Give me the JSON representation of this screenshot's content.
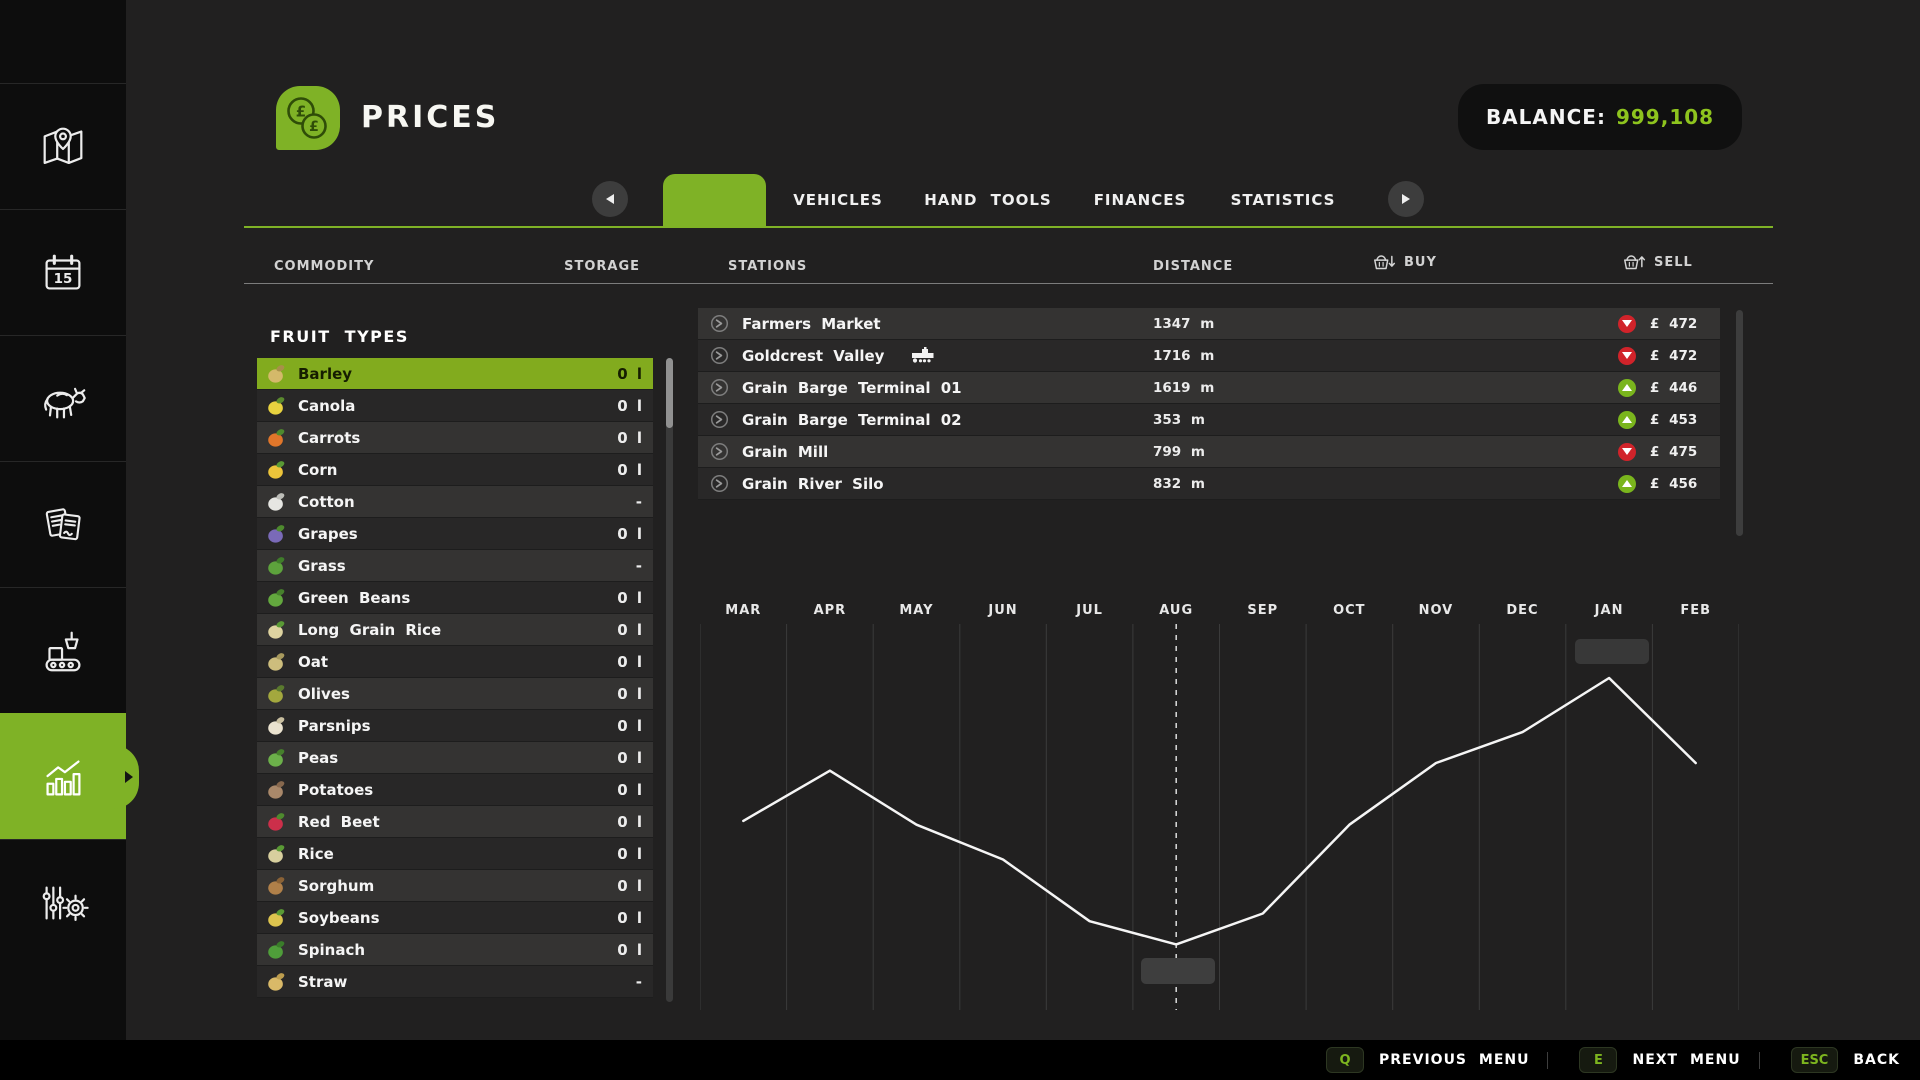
{
  "header": {
    "title": "PRICES",
    "currency_symbol": "£",
    "balance_label": "BALANCE:",
    "balance_value": "999,108"
  },
  "sidebar": {
    "active_item": "statistics",
    "items": [
      {
        "icon": "map-icon"
      },
      {
        "icon": "calendar-icon",
        "day": "15"
      },
      {
        "icon": "animals-icon"
      },
      {
        "icon": "contracts-icon"
      },
      {
        "icon": "production-icon"
      },
      {
        "icon": "statistics-icon",
        "active": true
      },
      {
        "icon": "settings-icon"
      }
    ]
  },
  "tabs": {
    "active_tab_label": "",
    "items": [
      "VEHICLES",
      "HAND TOOLS",
      "FINANCES",
      "STATISTICS"
    ]
  },
  "table_header": {
    "commodity": "COMMODITY",
    "storage": "STORAGE",
    "stations": "STATIONS",
    "distance": "DISTANCE",
    "buy": "BUY",
    "sell": "SELL"
  },
  "fruit_panel": {
    "title": "FRUIT TYPES",
    "items": [
      {
        "name": "Barley",
        "storage": "0 l",
        "selected": true,
        "color": "#d4b96a",
        "accent": "#a8904a"
      },
      {
        "name": "Canola",
        "storage": "0 l",
        "selected": false,
        "color": "#e8d23f",
        "accent": "#5a8a2e"
      },
      {
        "name": "Carrots",
        "storage": "0 l",
        "selected": false,
        "color": "#e0762a",
        "accent": "#4e8a2e"
      },
      {
        "name": "Corn",
        "storage": "0 l",
        "selected": false,
        "color": "#ecc43a",
        "accent": "#5a9a35"
      },
      {
        "name": "Cotton",
        "storage": "-",
        "selected": false,
        "color": "#e6e6e2",
        "accent": "#bdbdb8"
      },
      {
        "name": "Grapes",
        "storage": "0 l",
        "selected": false,
        "color": "#7a6ab8",
        "accent": "#4e8a2e"
      },
      {
        "name": "Grass",
        "storage": "-",
        "selected": false,
        "color": "#5da23c",
        "accent": "#3f7d2a"
      },
      {
        "name": "Green Beans",
        "storage": "0 l",
        "selected": false,
        "color": "#63a83e",
        "accent": "#46802c"
      },
      {
        "name": "Long Grain Rice",
        "storage": "0 l",
        "selected": false,
        "color": "#ded3a0",
        "accent": "#5a9a35"
      },
      {
        "name": "Oat",
        "storage": "0 l",
        "selected": false,
        "color": "#cdbd7d",
        "accent": "#a89a5e"
      },
      {
        "name": "Olives",
        "storage": "0 l",
        "selected": false,
        "color": "#a3a83e",
        "accent": "#5a7a2e"
      },
      {
        "name": "Parsnips",
        "storage": "0 l",
        "selected": false,
        "color": "#eae2cf",
        "accent": "#c9bfa0"
      },
      {
        "name": "Peas",
        "storage": "0 l",
        "selected": false,
        "color": "#6cb04a",
        "accent": "#46802c"
      },
      {
        "name": "Potatoes",
        "storage": "0 l",
        "selected": false,
        "color": "#a9886a",
        "accent": "#87684e"
      },
      {
        "name": "Red Beet",
        "storage": "0 l",
        "selected": false,
        "color": "#cc2f4a",
        "accent": "#4e8a2e"
      },
      {
        "name": "Rice",
        "storage": "0 l",
        "selected": false,
        "color": "#d8cf9e",
        "accent": "#5a9a35"
      },
      {
        "name": "Sorghum",
        "storage": "0 l",
        "selected": false,
        "color": "#b08049",
        "accent": "#8a6236"
      },
      {
        "name": "Soybeans",
        "storage": "0 l",
        "selected": false,
        "color": "#ddc44e",
        "accent": "#5a9a35"
      },
      {
        "name": "Spinach",
        "storage": "0 l",
        "selected": false,
        "color": "#4f9e3a",
        "accent": "#3a7d2a"
      },
      {
        "name": "Straw",
        "storage": "-",
        "selected": false,
        "color": "#d9b968",
        "accent": "#bd9d4e"
      }
    ]
  },
  "stations": [
    {
      "name": "Farmers Market",
      "train": false,
      "distance": "1347 m",
      "trend": "down",
      "sell_price": "£ 472"
    },
    {
      "name": "Goldcrest Valley",
      "train": true,
      "distance": "1716 m",
      "trend": "down",
      "sell_price": "£ 472"
    },
    {
      "name": "Grain Barge Terminal 01",
      "train": false,
      "distance": "1619 m",
      "trend": "up",
      "sell_price": "£ 446"
    },
    {
      "name": "Grain Barge Terminal 02",
      "train": false,
      "distance": "353 m",
      "trend": "up",
      "sell_price": "£ 453"
    },
    {
      "name": "Grain Mill",
      "train": false,
      "distance": "799 m",
      "trend": "down",
      "sell_price": "£ 475"
    },
    {
      "name": "Grain River Silo",
      "train": false,
      "distance": "832 m",
      "trend": "up",
      "sell_price": "£ 456"
    }
  ],
  "chart_data": {
    "type": "line",
    "title": "",
    "xlabel": "",
    "ylabel": "",
    "x": [
      "MAR",
      "APR",
      "MAY",
      "JUN",
      "JUL",
      "AUG",
      "SEP",
      "OCT",
      "NOV",
      "DEC",
      "JAN",
      "FEB"
    ],
    "values": [
      0.49,
      0.62,
      0.48,
      0.39,
      0.23,
      0.17,
      0.25,
      0.48,
      0.64,
      0.72,
      0.86,
      0.64
    ],
    "values_unit": "fraction_of_plot_height (no y-axis labels shown in UI)",
    "current_month": "AUG",
    "current_month_index": 5,
    "peak_month": "JAN",
    "grid": "vertical_month_gridlines",
    "line_color": "#f5f5f5",
    "marker_boxes": [
      {
        "month": "AUG",
        "position": "below-line"
      },
      {
        "month": "JAN",
        "position": "above-line"
      }
    ]
  },
  "footer": {
    "hints": [
      {
        "key": "Q",
        "label": "PREVIOUS MENU"
      },
      {
        "key": "E",
        "label": "NEXT MENU"
      },
      {
        "key": "ESC",
        "label": "BACK"
      }
    ]
  },
  "colors": {
    "accent_green": "#7fb226",
    "selected_row_green": "#82ab1e",
    "balance_value_green": "#8ec41e",
    "trend_up_green": "#7ab51d",
    "trend_down_red": "#d1232a"
  }
}
